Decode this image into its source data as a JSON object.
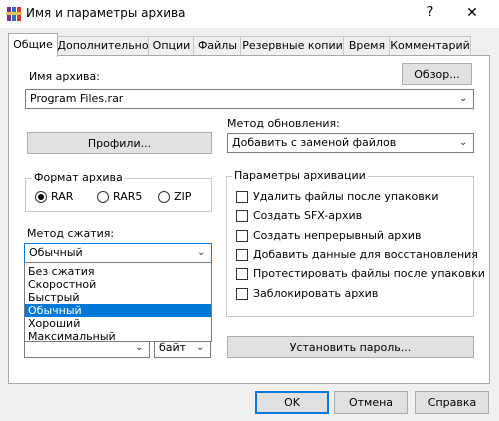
{
  "window": {
    "title": "Имя и параметры архива",
    "help": "?",
    "close": "✕"
  },
  "tabs": [
    {
      "label": "Общие",
      "active": true
    },
    {
      "label": "Дополнительно"
    },
    {
      "label": "Опции"
    },
    {
      "label": "Файлы"
    },
    {
      "label": "Резервные копии"
    },
    {
      "label": "Время"
    },
    {
      "label": "Комментарий"
    }
  ],
  "archive_name": {
    "label": "Имя архива:",
    "browse_button": "Обзор...",
    "value": "Program Files.rar"
  },
  "profiles_button": "Профили...",
  "update_method": {
    "label": "Метод обновления:",
    "value": "Добавить с заменой файлов"
  },
  "archive_format": {
    "title": "Формат архива",
    "options": [
      "RAR",
      "RAR5",
      "ZIP"
    ],
    "selected": "RAR"
  },
  "compression": {
    "label": "Метод сжатия:",
    "value": "Обычный",
    "options": [
      "Без сжатия",
      "Скоростной",
      "Быстрый",
      "Обычный",
      "Хороший",
      "Максимальный"
    ],
    "selected_index": 3
  },
  "split_unit": {
    "value": "байт"
  },
  "archive_options": {
    "title": "Параметры архивации",
    "items": [
      "Удалить файлы после упаковки",
      "Создать SFX-архив",
      "Создать непрерывный архив",
      "Добавить данные для восстановления",
      "Протестировать файлы после упаковки",
      "Заблокировать архив"
    ]
  },
  "set_password_button": "Установить пароль...",
  "footer": {
    "ok": "OK",
    "cancel": "Отмена",
    "help": "Справка"
  },
  "colors": {
    "accent": "#0078d7",
    "background": "#f0f0f0"
  }
}
